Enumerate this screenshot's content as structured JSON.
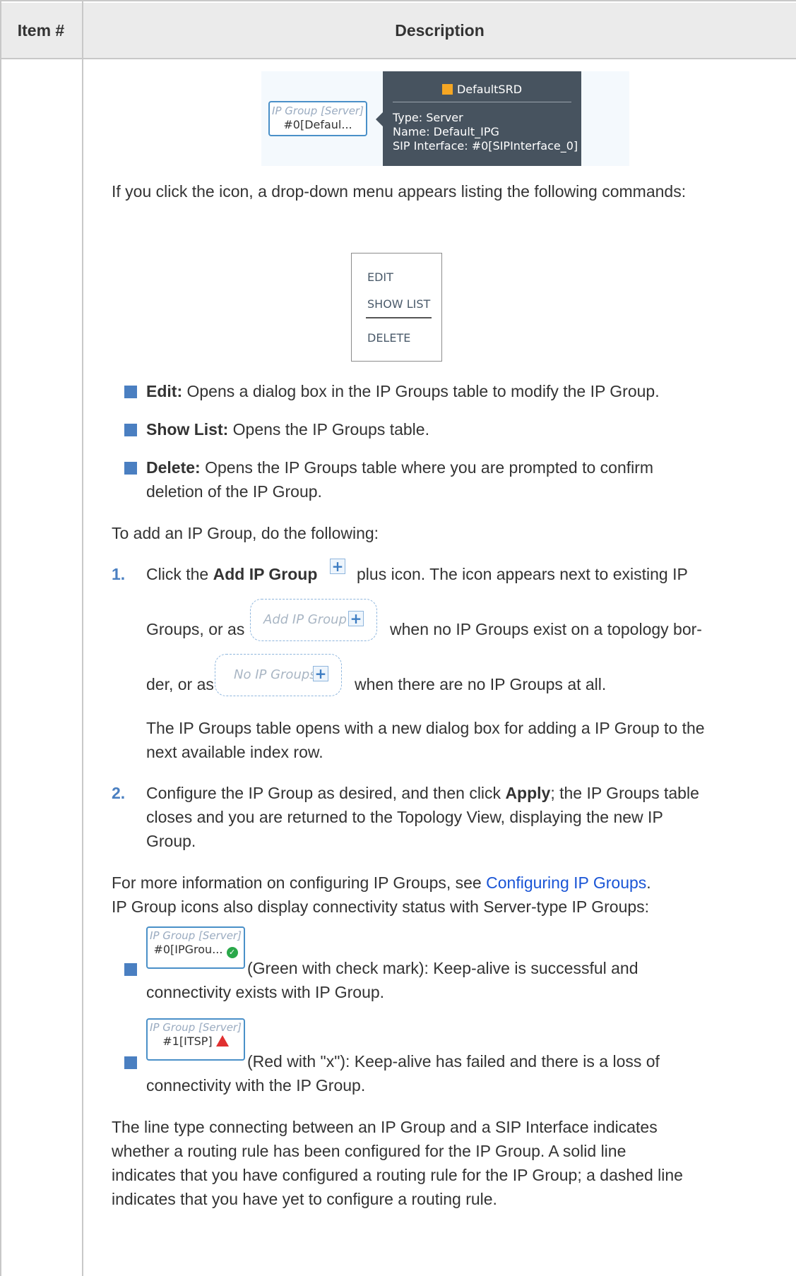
{
  "table": {
    "col_item": "Item #",
    "col_desc": "Description"
  },
  "tooltip": {
    "ipg_type": "IP Group [Server]",
    "ipg_value": "#0[Defaul...",
    "srd_name": "DefaultSRD",
    "type_line": "Type: Server",
    "name_line": "Name: Default_IPG",
    "sip_line": "SIP Interface: #0[SIPInterface_0]",
    "srd_color": "#f5a623"
  },
  "intro": "If you click the icon, a drop-down menu appears listing the following commands:",
  "menu": {
    "edit": "EDIT",
    "show_list": "SHOW LIST",
    "delete": "DELETE"
  },
  "commands": [
    {
      "term": "Edit:",
      "text": " Opens a dialog box in the IP Groups table to modify the IP Group."
    },
    {
      "term": "Show List:",
      "text": " Opens the IP Groups table."
    },
    {
      "term": "Delete:",
      "text": " Opens the IP Groups table where you are prompted to confirm",
      "text2": "deletion of the IP Group."
    }
  ],
  "add_intro": "To add an IP Group, do the following:",
  "steps": {
    "s1_num": "1.",
    "s1_a": "Click the ",
    "s1_b": "Add IP Group",
    "s1_c": " plus icon. The icon appears next to existing IP",
    "s1_d": "Groups, or as",
    "s1_e": "when no IP Groups exist on a topology bor-",
    "s1_f": "der, or as",
    "s1_g": "when there are no IP Groups at all.",
    "add_box": "Add IP Group",
    "none_box": "No IP Groups",
    "s1_p1": "The IP Groups table opens with a new dialog box for adding a IP Group to the",
    "s1_p2": "next available index row.",
    "s2_num": "2.",
    "s2_a": "Configure the IP Group as desired, and then click ",
    "s2_b": "Apply",
    "s2_c": "; the IP Groups table",
    "s2_l2": "closes and you are returned to the Topology View, displaying the new IP",
    "s2_l3": "Group."
  },
  "more": {
    "a": "For more information on configuring IP Groups, see ",
    "link": "Configuring IP Groups",
    "b": "."
  },
  "status_intro": "IP Group icons also display connectivity status with Server-type IP Groups:",
  "status": [
    {
      "type": "IP Group [Server]",
      "value": "#0[IPGrou...",
      "text1": "(Green with check mark): Keep-alive is successful and",
      "text2": "connectivity exists with IP Group."
    },
    {
      "type": "IP Group [Server]",
      "value": "#1[ITSP]",
      "text1": "(Red with \"x\"): Keep-alive has failed and there is a loss of",
      "text2": "connectivity with the IP Group."
    }
  ],
  "closing": [
    "The line type connecting between an IP Group and a SIP Interface indicates",
    "whether a routing rule has been configured for the IP Group. A solid line",
    "indicates that you have configured a routing rule for the IP Group; a dashed line",
    "indicates that you have yet to configure a routing rule."
  ],
  "colors": {
    "bullet": "#4a7fc1",
    "link": "#1a55d6",
    "ok": "#2aa84a",
    "error": "#e03030"
  }
}
